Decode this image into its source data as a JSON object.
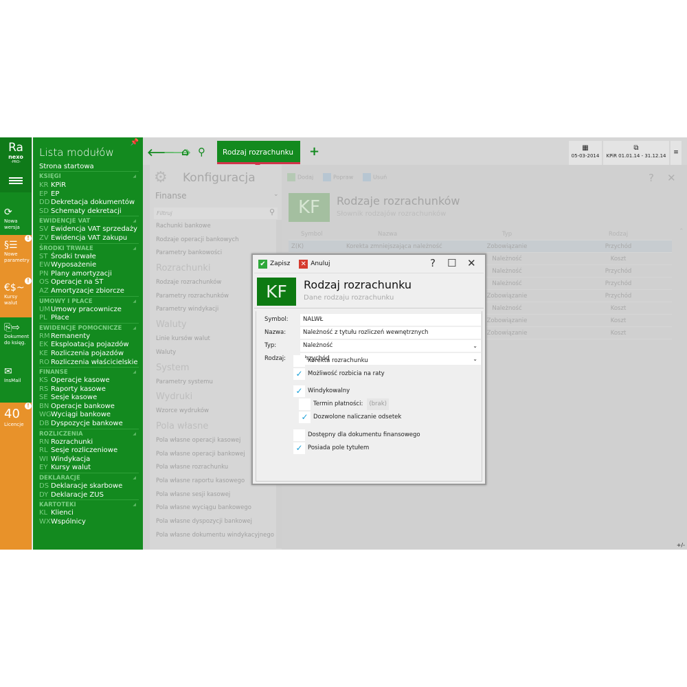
{
  "logo": {
    "line1": "Ra",
    "line2": "nexo",
    "line3": "-PRO-"
  },
  "tiles": [
    {
      "label": "Nowa wersja",
      "icon": "refresh-icon",
      "glyph": "⟳",
      "alert": false
    },
    {
      "label": "Nowe parametry",
      "icon": "parameters-icon",
      "glyph": "§☰",
      "alert": true
    },
    {
      "label": "Kursy walut",
      "icon": "currency-icon",
      "glyph": "€$~",
      "alert": true
    },
    {
      "label": "Dokument do księg.",
      "icon": "document-icon",
      "glyph": "⎘⇨",
      "alert": false
    },
    {
      "label": "InsMail",
      "icon": "mail-icon",
      "glyph": "✉",
      "alert": false
    },
    {
      "label": "Licencje",
      "icon": "license-count",
      "glyph": "40",
      "alert": true
    }
  ],
  "modules": {
    "title": "Lista modułów",
    "start": "Strona startowa",
    "groups": [
      {
        "name": "KSIĘGI",
        "items": [
          [
            "KR",
            "KPiR"
          ],
          [
            "EP",
            "EP"
          ],
          [
            "DD",
            "Dekretacja dokumentów"
          ],
          [
            "SD",
            "Schematy dekretacji"
          ]
        ]
      },
      {
        "name": "EWIDENCJE VAT",
        "items": [
          [
            "SV",
            "Ewidencja VAT sprzedaży"
          ],
          [
            "ZV",
            "Ewidencja VAT zakupu"
          ]
        ]
      },
      {
        "name": "ŚRODKI TRWAŁE",
        "items": [
          [
            "ST",
            "Środki trwałe"
          ],
          [
            "EW",
            "Wyposażenie"
          ],
          [
            "PN",
            "Plany amortyzacji"
          ],
          [
            "OS",
            "Operacje na ŚT"
          ],
          [
            "AZ",
            "Amortyzacje zbiorcze"
          ]
        ]
      },
      {
        "name": "UMOWY I PŁACE",
        "items": [
          [
            "UM",
            "Umowy pracownicze"
          ],
          [
            "PL",
            "Płace"
          ]
        ]
      },
      {
        "name": "EWIDENCJE POMOCNICZE",
        "items": [
          [
            "RM",
            "Remanenty"
          ],
          [
            "EK",
            "Eksploatacja pojazdów"
          ],
          [
            "KE",
            "Rozliczenia pojazdów"
          ],
          [
            "RO",
            "Rozliczenia właścicielskie"
          ]
        ]
      },
      {
        "name": "FINANSE",
        "items": [
          [
            "KS",
            "Operacje kasowe"
          ],
          [
            "RS",
            "Raporty kasowe"
          ],
          [
            "SE",
            "Sesje kasowe"
          ],
          [
            "BN",
            "Operacje bankowe"
          ],
          [
            "WG",
            "Wyciągi bankowe"
          ],
          [
            "DB",
            "Dyspozycje bankowe"
          ]
        ]
      },
      {
        "name": "ROZLICZENIA",
        "items": [
          [
            "RN",
            "Rozrachunki"
          ],
          [
            "RL",
            "Sesje rozliczeniowe"
          ],
          [
            "WI",
            "Windykacja"
          ],
          [
            "EY",
            "Kursy walut"
          ]
        ]
      },
      {
        "name": "DEKLARACJE",
        "items": [
          [
            "DS",
            "Deklaracje skarbowe"
          ],
          [
            "DY",
            "Deklaracje ZUS"
          ]
        ]
      },
      {
        "name": "KARTOTEKI",
        "items": [
          [
            "KL",
            "Klienci"
          ],
          [
            "WX",
            "Wspólnicy"
          ]
        ]
      }
    ]
  },
  "topbar": {
    "tab": "Rodzaj rozrachunku",
    "date": "05-03-2014",
    "period": "KPiR 01.01.14 - 31.12.14"
  },
  "config": {
    "title": "Konfiguracja",
    "section": "Finanse",
    "filter_placeholder": "Filtruj",
    "list": [
      {
        "t": "i",
        "l": "Rachunki bankowe"
      },
      {
        "t": "i",
        "l": "Rodzaje operacji bankowych"
      },
      {
        "t": "i",
        "l": "Parametry bankowości"
      },
      {
        "t": "h",
        "l": "Rozrachunki"
      },
      {
        "t": "i",
        "l": "Rodzaje rozrachunków"
      },
      {
        "t": "i",
        "l": "Parametry rozrachunków"
      },
      {
        "t": "i",
        "l": "Parametry windykacji"
      },
      {
        "t": "h",
        "l": "Waluty"
      },
      {
        "t": "i",
        "l": "Linie kursów walut"
      },
      {
        "t": "i",
        "l": "Waluty"
      },
      {
        "t": "h",
        "l": "System"
      },
      {
        "t": "i",
        "l": "Parametry systemu"
      },
      {
        "t": "h",
        "l": "Wydruki"
      },
      {
        "t": "i",
        "l": "Wzorce wydruków"
      },
      {
        "t": "h",
        "l": "Pola własne"
      },
      {
        "t": "i",
        "l": "Pola własne operacji kasowej"
      },
      {
        "t": "i",
        "l": "Pola własne operacji bankowej"
      },
      {
        "t": "i",
        "l": "Pola własne rozrachunku"
      },
      {
        "t": "i",
        "l": "Pola własne raportu kasowego"
      },
      {
        "t": "i",
        "l": "Pola własne sesji kasowej"
      },
      {
        "t": "i",
        "l": "Pola własne wyciągu bankowego"
      },
      {
        "t": "i",
        "l": "Pola własne dyspozycji bankowej"
      },
      {
        "t": "i",
        "l": "Pola własne dokumentu windykacyjnego"
      }
    ]
  },
  "main": {
    "toolbar": {
      "add": "Dodaj",
      "edit": "Popraw",
      "delete": "Usuń"
    },
    "badge": "KF",
    "title": "Rodzaje rozrachunków",
    "subtitle": "Słownik rodzajów rozrachunków",
    "columns": [
      "Symbol",
      "Nazwa",
      "Typ",
      "Rodzaj"
    ],
    "rows": [
      [
        "Z(K)",
        "Korekta zmniejszająca należność",
        "Zobowiązanie",
        "Przychód"
      ],
      [
        "",
        "",
        "Należność",
        "Koszt"
      ],
      [
        "",
        "",
        "Należność",
        "Przychód"
      ],
      [
        "",
        "",
        "Należność",
        "Przychód"
      ],
      [
        "",
        "",
        "Zobowiązanie",
        "Przychód"
      ],
      [
        "",
        "",
        "Należność",
        "Koszt"
      ],
      [
        "",
        "",
        "Zobowiązanie",
        "Koszt"
      ],
      [
        "",
        "",
        "Zobowiązanie",
        "Koszt"
      ]
    ],
    "plusminus": "+/-"
  },
  "dialog": {
    "save": "Zapisz",
    "cancel": "Anuluj",
    "badge": "KF",
    "title": "Rodzaj rozrachunku",
    "subtitle": "Dane rodzaju rozrachunku",
    "fields": {
      "symbol_label": "Symbol:",
      "symbol": "NALWŁ",
      "name_label": "Nazwa:",
      "name": "Należność z tytułu rozliczeń wewnętrznych",
      "type_label": "Typ:",
      "type": "Należność",
      "kind_label": "Rodzaj:",
      "kind": "Przychód"
    },
    "checks": [
      {
        "label": "Korekta rozrachunku",
        "checked": false
      },
      {
        "label": "Możliwość rozbicia na raty",
        "checked": true
      },
      {
        "label": "Windykowalny",
        "checked": true
      },
      {
        "label": "Termin płatności:",
        "checked": false,
        "value": "(brak)"
      },
      {
        "label": "Dozwolone naliczanie odsetek",
        "checked": true
      },
      {
        "label": "Dostępny dla dokumentu finansowego",
        "checked": false
      },
      {
        "label": "Posiada pole tytułem",
        "checked": true
      }
    ]
  }
}
